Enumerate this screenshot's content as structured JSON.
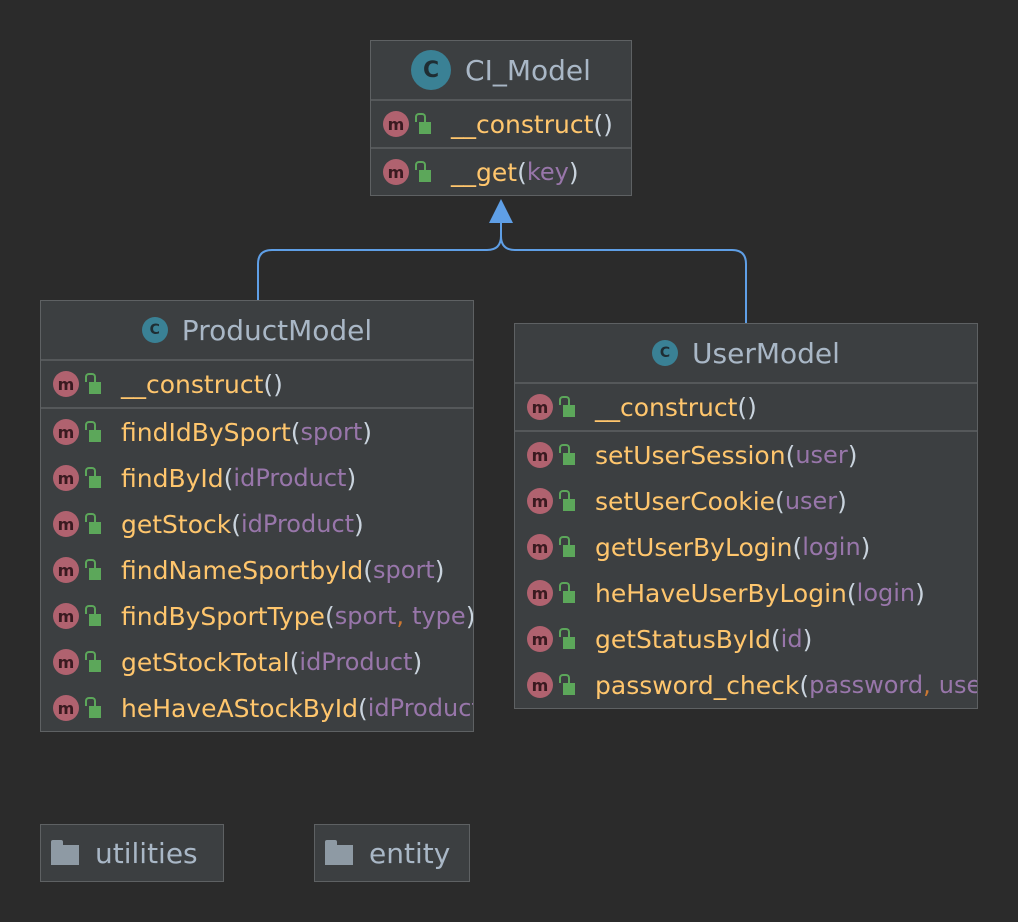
{
  "classes": {
    "ci_model": {
      "name": "CI_Model",
      "icon": "class-icon",
      "sections": [
        [
          {
            "name": "__construct",
            "params": []
          }
        ],
        [
          {
            "name": "__get",
            "params": [
              "key"
            ]
          }
        ]
      ]
    },
    "product_model": {
      "name": "ProductModel",
      "icon": "class-icon",
      "sections": [
        [
          {
            "name": "__construct",
            "params": []
          }
        ],
        [
          {
            "name": "findIdBySport",
            "params": [
              "sport"
            ]
          },
          {
            "name": "findById",
            "params": [
              "idProduct"
            ]
          },
          {
            "name": "getStock",
            "params": [
              "idProduct"
            ]
          },
          {
            "name": "findNameSportbyId",
            "params": [
              "sport"
            ]
          },
          {
            "name": "findBySportType",
            "params": [
              "sport",
              "type"
            ]
          },
          {
            "name": "getStockTotal",
            "params": [
              "idProduct"
            ]
          },
          {
            "name": "heHaveAStockById",
            "params": [
              "idProduct"
            ]
          }
        ]
      ]
    },
    "user_model": {
      "name": "UserModel",
      "icon": "class-icon",
      "sections": [
        [
          {
            "name": "__construct",
            "params": []
          }
        ],
        [
          {
            "name": "setUserSession",
            "params": [
              "user"
            ]
          },
          {
            "name": "setUserCookie",
            "params": [
              "user"
            ]
          },
          {
            "name": "getUserByLogin",
            "params": [
              "login"
            ]
          },
          {
            "name": "heHaveUserByLogin",
            "params": [
              "login"
            ]
          },
          {
            "name": "getStatusById",
            "params": [
              "id"
            ]
          },
          {
            "name": "password_check",
            "params": [
              "password",
              "user"
            ]
          }
        ]
      ]
    }
  },
  "packages": [
    {
      "label": "utilities",
      "icon": "folder-icon"
    },
    {
      "label": "entity",
      "icon": "folder-icon"
    }
  ],
  "icons": {
    "class_letter": "C",
    "method_letter": "m"
  },
  "colors": {
    "background": "#2b2b2b",
    "class_icon": "#3a8195",
    "method_icon": "#b0626f",
    "public_icon": "#5ca75a",
    "method_name": "#ffc66d",
    "param": "#9876aa",
    "inheritance_arrow": "#5f9fe6"
  }
}
